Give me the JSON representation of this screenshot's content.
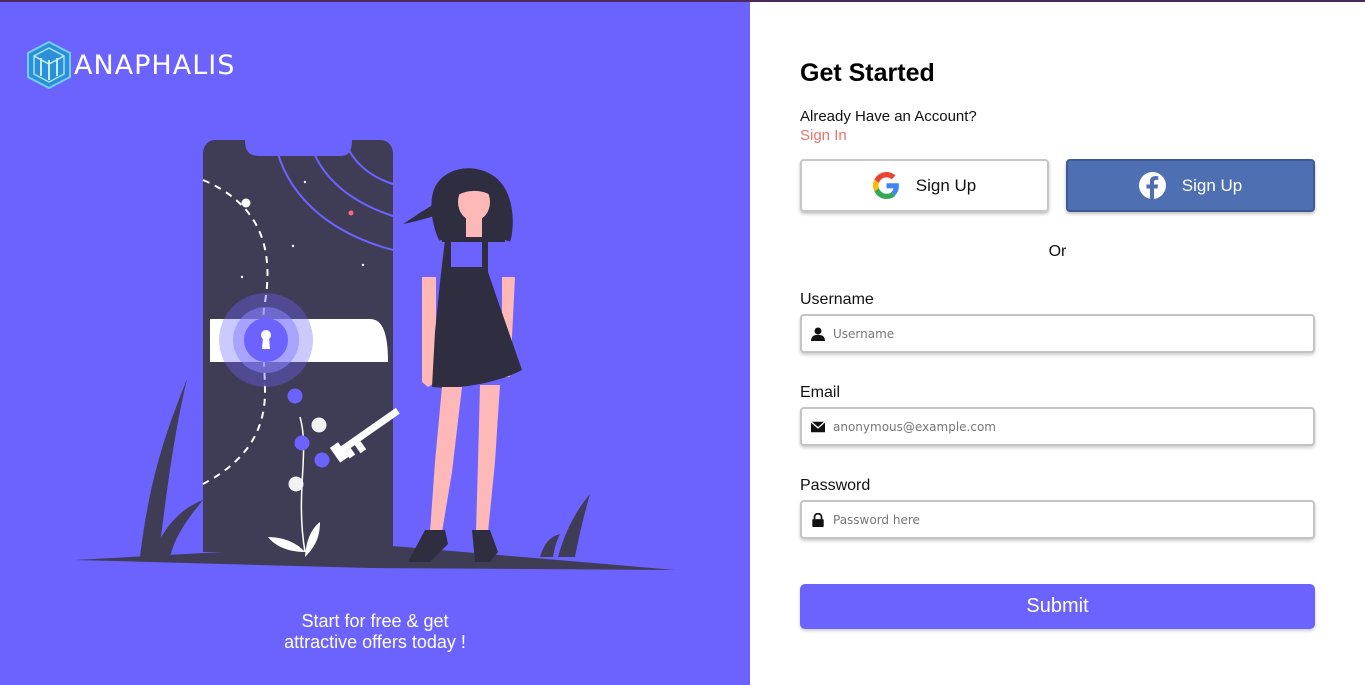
{
  "brand": {
    "name": "ANAPHALIS"
  },
  "left": {
    "tagline_line1": "Start for free & get",
    "tagline_line2": "attractive offers today !"
  },
  "form": {
    "title": "Get Started",
    "have_account": "Already Have an Account?",
    "sign_in": "Sign In",
    "google_label": "Sign Up",
    "facebook_label": "Sign Up",
    "or": "Or",
    "username": {
      "label": "Username",
      "placeholder": "Username",
      "icon": "user-icon"
    },
    "email": {
      "label": "Email",
      "placeholder": "anonymous@example.com",
      "icon": "envelope-icon"
    },
    "password": {
      "label": "Password",
      "placeholder": "Password here",
      "icon": "lock-icon"
    },
    "submit": "Submit"
  },
  "colors": {
    "primary": "#6c63ff",
    "facebook": "#4f6fb3",
    "link": "#e8736b",
    "illustration_dark": "#3f3d56",
    "skin": "#ffb8b8"
  }
}
